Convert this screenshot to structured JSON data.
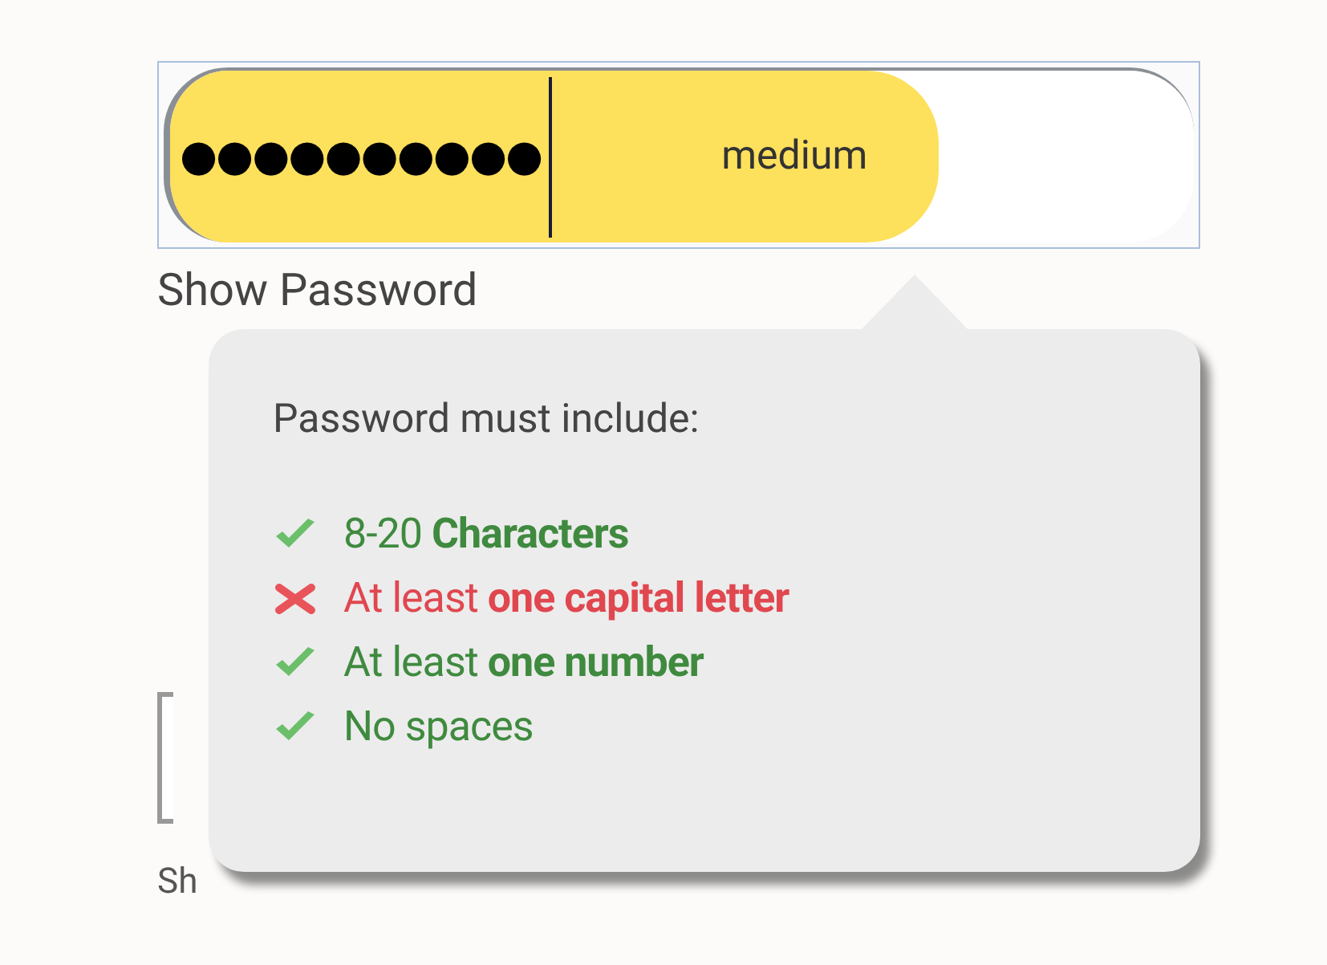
{
  "password_field": {
    "value": "●●●●●●●●●●",
    "strength": {
      "label": "medium",
      "level": 0.75,
      "color": "#fde05c"
    }
  },
  "show_password_label": "Show Password",
  "tooltip": {
    "title": "Password must include:",
    "rules": [
      {
        "text": "8-20 **Characters**",
        "met": true
      },
      {
        "text": "At least **one capital letter**",
        "met": false
      },
      {
        "text": "At least **one number**",
        "met": true
      },
      {
        "text": "No spaces",
        "met": true
      }
    ]
  },
  "second_show_password_label": "Sh"
}
